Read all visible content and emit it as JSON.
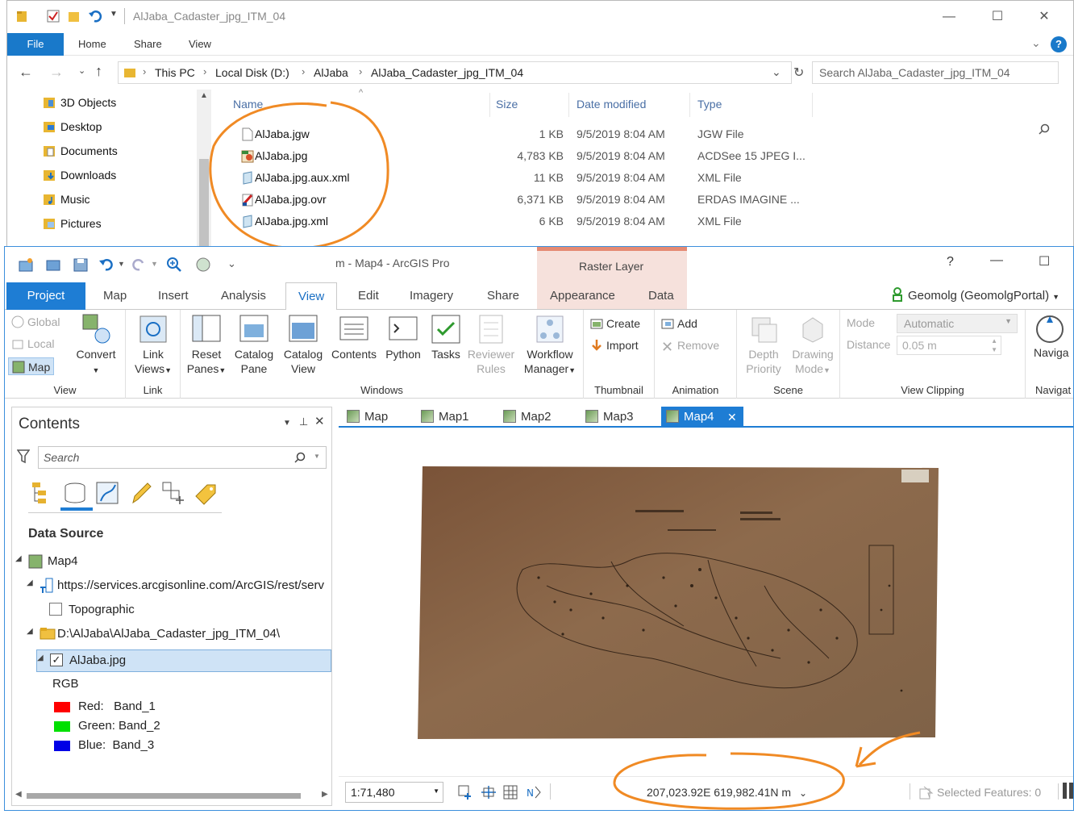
{
  "explorer": {
    "title": "AlJaba_Cadaster_jpg_ITM_04",
    "window_buttons": {
      "minimize": "—",
      "maximize": "☐",
      "close": "✕"
    },
    "ribbon_tabs": [
      "File",
      "Home",
      "Share",
      "View"
    ],
    "breadcrumb": [
      "This PC",
      "Local Disk (D:)",
      "AlJaba",
      "AlJaba_Cadaster_jpg_ITM_04"
    ],
    "search_placeholder": "Search AlJaba_Cadaster_jpg_ITM_04",
    "nav_items": [
      "3D Objects",
      "Desktop",
      "Documents",
      "Downloads",
      "Music",
      "Pictures"
    ],
    "columns": [
      "Name",
      "Size",
      "Date modified",
      "Type"
    ],
    "files": [
      {
        "name": "AlJaba.jgw",
        "size": "1 KB",
        "date": "9/5/2019 8:04 AM",
        "type": "JGW File",
        "icon": "blank-file-icon"
      },
      {
        "name": "AlJaba.jpg",
        "size": "4,783 KB",
        "date": "9/5/2019 8:04 AM",
        "type": "ACDSee 15 JPEG I...",
        "icon": "image-file-icon"
      },
      {
        "name": "AlJaba.jpg.aux.xml",
        "size": "11 KB",
        "date": "9/5/2019 8:04 AM",
        "type": "XML File",
        "icon": "xml-file-icon"
      },
      {
        "name": "AlJaba.jpg.ovr",
        "size": "6,371 KB",
        "date": "9/5/2019 8:04 AM",
        "type": "ERDAS IMAGINE ...",
        "icon": "erdas-file-icon"
      },
      {
        "name": "AlJaba.jpg.xml",
        "size": "6 KB",
        "date": "9/5/2019 8:04 AM",
        "type": "XML File",
        "icon": "xml-file-icon"
      }
    ]
  },
  "arcgis": {
    "title": "m - Map4 - ArcGIS Pro",
    "help": "?",
    "context_tab": "Raster Layer",
    "tabs": [
      "Project",
      "Map",
      "Insert",
      "Analysis",
      "View",
      "Edit",
      "Imagery",
      "Share",
      "Appearance",
      "Data"
    ],
    "active_tab": "View",
    "user": "Geomolg (GeomolgPortal)",
    "ribbon": {
      "view_group": {
        "label": "View",
        "global": "Global",
        "local": "Local",
        "map": "Map",
        "convert": "Convert"
      },
      "link_group": {
        "label": "Link",
        "link_views": "Link Views"
      },
      "windows_group": {
        "label": "Windows",
        "reset_panes": "Reset Panes",
        "catalog_pane": "Catalog Pane",
        "catalog_view": "Catalog View",
        "contents": "Contents",
        "python": "Python",
        "tasks": "Tasks",
        "reviewer_rules": "Reviewer Rules",
        "workflow_manager": "Workflow Manager"
      },
      "thumbnail_group": {
        "label": "Thumbnail",
        "create": "Create",
        "import": "Import"
      },
      "animation_group": {
        "label": "Animation",
        "add": "Add",
        "remove": "Remove"
      },
      "scene_group": {
        "label": "Scene",
        "depth_priority": "Depth Priority",
        "drawing_mode": "Drawing Mode"
      },
      "clipping_group": {
        "label": "View Clipping",
        "mode_label": "Mode",
        "mode_value": "Automatic",
        "distance_label": "Distance",
        "distance_value": "0.05  m"
      },
      "navigate_group": {
        "label": "Navigat",
        "navigate": "Naviga"
      }
    },
    "contents": {
      "title": "Contents",
      "search_placeholder": "Search",
      "section": "Data Source",
      "tree": {
        "map": "Map4",
        "service": "https://services.arcgisonline.com/ArcGIS/rest/serv",
        "topographic": "Topographic",
        "folder": "D:\\AlJaba\\AlJaba_Cadaster_jpg_ITM_04\\",
        "layer": "AlJaba.jpg",
        "rgb": "RGB",
        "bands": [
          {
            "label": "Red:   Band_1",
            "color": "#ff0000"
          },
          {
            "label": "Green: Band_2",
            "color": "#00e000"
          },
          {
            "label": "Blue:  Band_3",
            "color": "#0000e6"
          }
        ]
      }
    },
    "map_tabs": [
      "Map",
      "Map1",
      "Map2",
      "Map3",
      "Map4"
    ],
    "active_map_tab": "Map4",
    "status": {
      "scale": "1:71,480",
      "coordinates": "207,023.92E 619,982.41N m",
      "selected_features": "Selected Features: 0"
    }
  }
}
